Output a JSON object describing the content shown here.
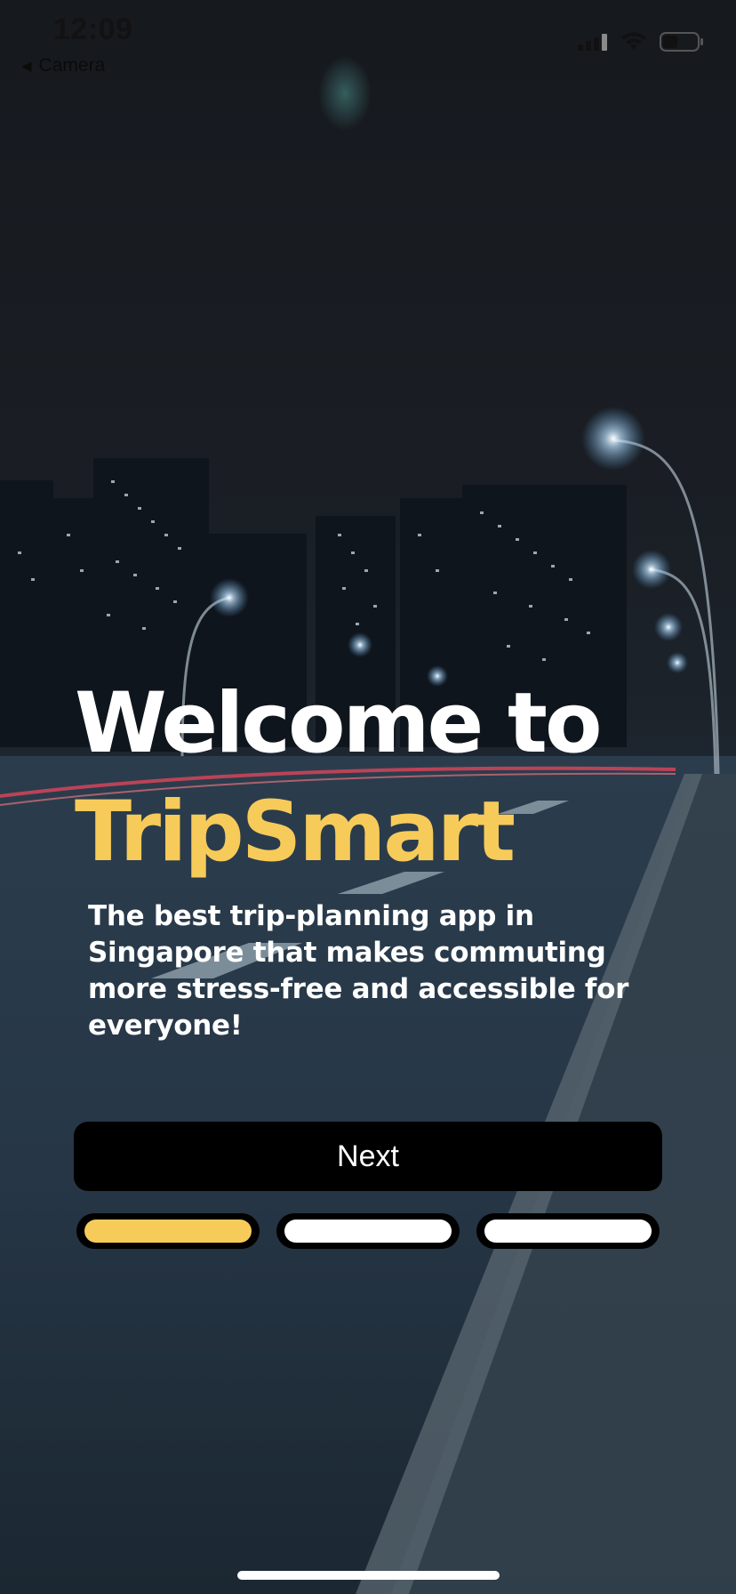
{
  "status_bar": {
    "time": "12:09",
    "back_label": "Camera",
    "back_icon": "back-triangle-icon",
    "signal_icon": "cellular-signal-icon",
    "wifi_icon": "wifi-icon",
    "battery_icon": "battery-icon"
  },
  "welcome": {
    "title_line1": "Welcome to",
    "title_line2": "TripSmart",
    "subtitle": "The best trip-planning app in Singapore that makes commuting more stress-free and accessible for everyone!"
  },
  "next_button": {
    "label": "Next"
  },
  "pager": {
    "total_pages": 3,
    "active_page": 1
  },
  "colors": {
    "accent": "#f7cb5a",
    "button_bg": "#000000",
    "text": "#ffffff"
  }
}
